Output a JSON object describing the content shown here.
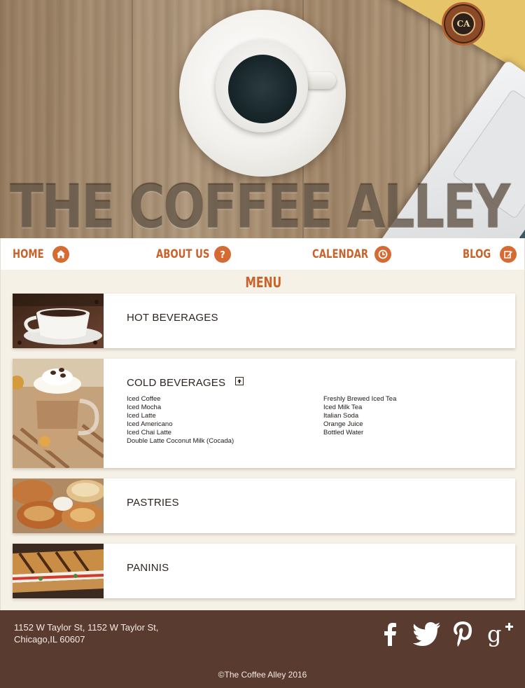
{
  "brand": {
    "hero_title": "THE COFFEE ALLEY",
    "seal_text": "CA"
  },
  "nav": {
    "items": [
      {
        "label": "HOME",
        "icon": "home-icon"
      },
      {
        "label": "ABOUT US",
        "icon": "help-icon"
      },
      {
        "label": "CALENDAR",
        "icon": "clock-icon"
      },
      {
        "label": "BLOG",
        "icon": "edit-icon"
      }
    ]
  },
  "menu": {
    "title": "MENU",
    "sections": [
      {
        "title": "HOT BEVERAGES",
        "image": "hot-coffee-cup"
      },
      {
        "title": "COLD BEVERAGES",
        "image": "iced-coffee-glass",
        "expanded": true,
        "items_left": [
          "Iced Coffee",
          "Iced Mocha",
          "Iced Latte",
          "Iced Americano",
          "Iced Chai Latte",
          "Double Latte Coconut Milk (Cocada)"
        ],
        "items_right": [
          "Freshly Brewed Iced Tea",
          "Iced Milk Tea",
          "Italian Soda",
          "Orange Juice",
          "Bottled Water"
        ]
      },
      {
        "title": "PASTRIES",
        "image": "pastries"
      },
      {
        "title": "PANINIS",
        "image": "panini"
      }
    ]
  },
  "footer": {
    "address_line1": "1152 W Taylor St, 1152 W Taylor St,",
    "address_line2": "Chicago,IL 60607",
    "social": [
      "facebook-icon",
      "twitter-icon",
      "pinterest-icon",
      "google-plus-icon"
    ],
    "copyright": "©The Coffee Alley 2016"
  },
  "colors": {
    "accent": "#c9632b",
    "background": "#f6f1e6",
    "footer": "#5a3b30"
  }
}
